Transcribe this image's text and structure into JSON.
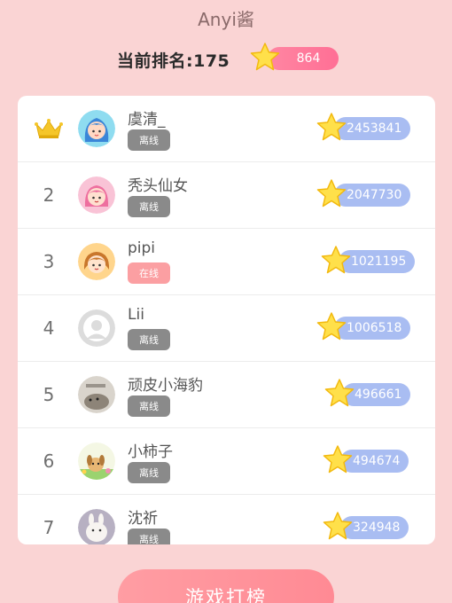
{
  "header": {
    "title": "Anyi酱",
    "rank_label": "当前排名:175",
    "my_score": "864"
  },
  "leaderboard": {
    "rows": [
      {
        "rank": "1",
        "name": "虞清_",
        "status": "离线",
        "score": "2453841"
      },
      {
        "rank": "2",
        "name": "秃头仙女",
        "status": "离线",
        "score": "2047730"
      },
      {
        "rank": "3",
        "name": "pipi",
        "status": "在线",
        "score": "1021195"
      },
      {
        "rank": "4",
        "name": "Lii",
        "status": "离线",
        "score": "1006518"
      },
      {
        "rank": "5",
        "name": "顽皮小海豹",
        "status": "离线",
        "score": "496661"
      },
      {
        "rank": "6",
        "name": "小柿子",
        "status": "离线",
        "score": "494674"
      },
      {
        "rank": "7",
        "name": "沈祈",
        "status": "离线",
        "score": "324948"
      }
    ]
  },
  "footer": {
    "play_button": "游戏打榜"
  },
  "colors": {
    "background": "#fad4d4",
    "score_pill": "#a9bdf2",
    "my_score_pill": "#ff7a9a",
    "offline_badge": "#8a8a8a",
    "online_badge": "#fb9fa2"
  },
  "icons": {
    "first_place": "crown-icon",
    "score": "star-icon"
  }
}
